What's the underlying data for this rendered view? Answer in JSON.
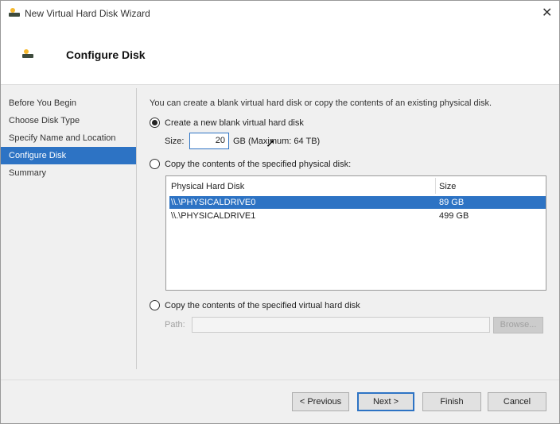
{
  "window": {
    "title": "New Virtual Hard Disk Wizard",
    "close_icon": "close-icon"
  },
  "header": {
    "title": "Configure Disk"
  },
  "nav": {
    "items": [
      {
        "label": "Before You Begin",
        "selected": false
      },
      {
        "label": "Choose Disk Type",
        "selected": false
      },
      {
        "label": "Specify Name and Location",
        "selected": false
      },
      {
        "label": "Configure Disk",
        "selected": true
      },
      {
        "label": "Summary",
        "selected": false
      }
    ]
  },
  "main": {
    "intro": "You can create a blank virtual hard disk or copy the contents of an existing physical disk.",
    "option_new": {
      "label": "Create a new blank virtual hard disk",
      "selected": true
    },
    "size_label": "Size:",
    "size_value": "20",
    "size_unit": "GB (Maximum: 64 TB)",
    "option_physical": {
      "label": "Copy the contents of the specified physical disk:",
      "selected": false
    },
    "table": {
      "columns": [
        "Physical Hard Disk",
        "Size"
      ],
      "rows": [
        {
          "disk": "\\\\.\\PHYSICALDRIVE0",
          "size": "89 GB",
          "selected": true
        },
        {
          "disk": "\\\\.\\PHYSICALDRIVE1",
          "size": "499 GB",
          "selected": false
        }
      ]
    },
    "option_virtual": {
      "label": "Copy the contents of the specified virtual hard disk",
      "selected": false
    },
    "path_label": "Path:",
    "path_value": "",
    "browse_label": "Browse..."
  },
  "footer": {
    "previous": "< Previous",
    "next": "Next >",
    "finish": "Finish",
    "cancel": "Cancel"
  },
  "colors": {
    "accent": "#2d73c4"
  }
}
